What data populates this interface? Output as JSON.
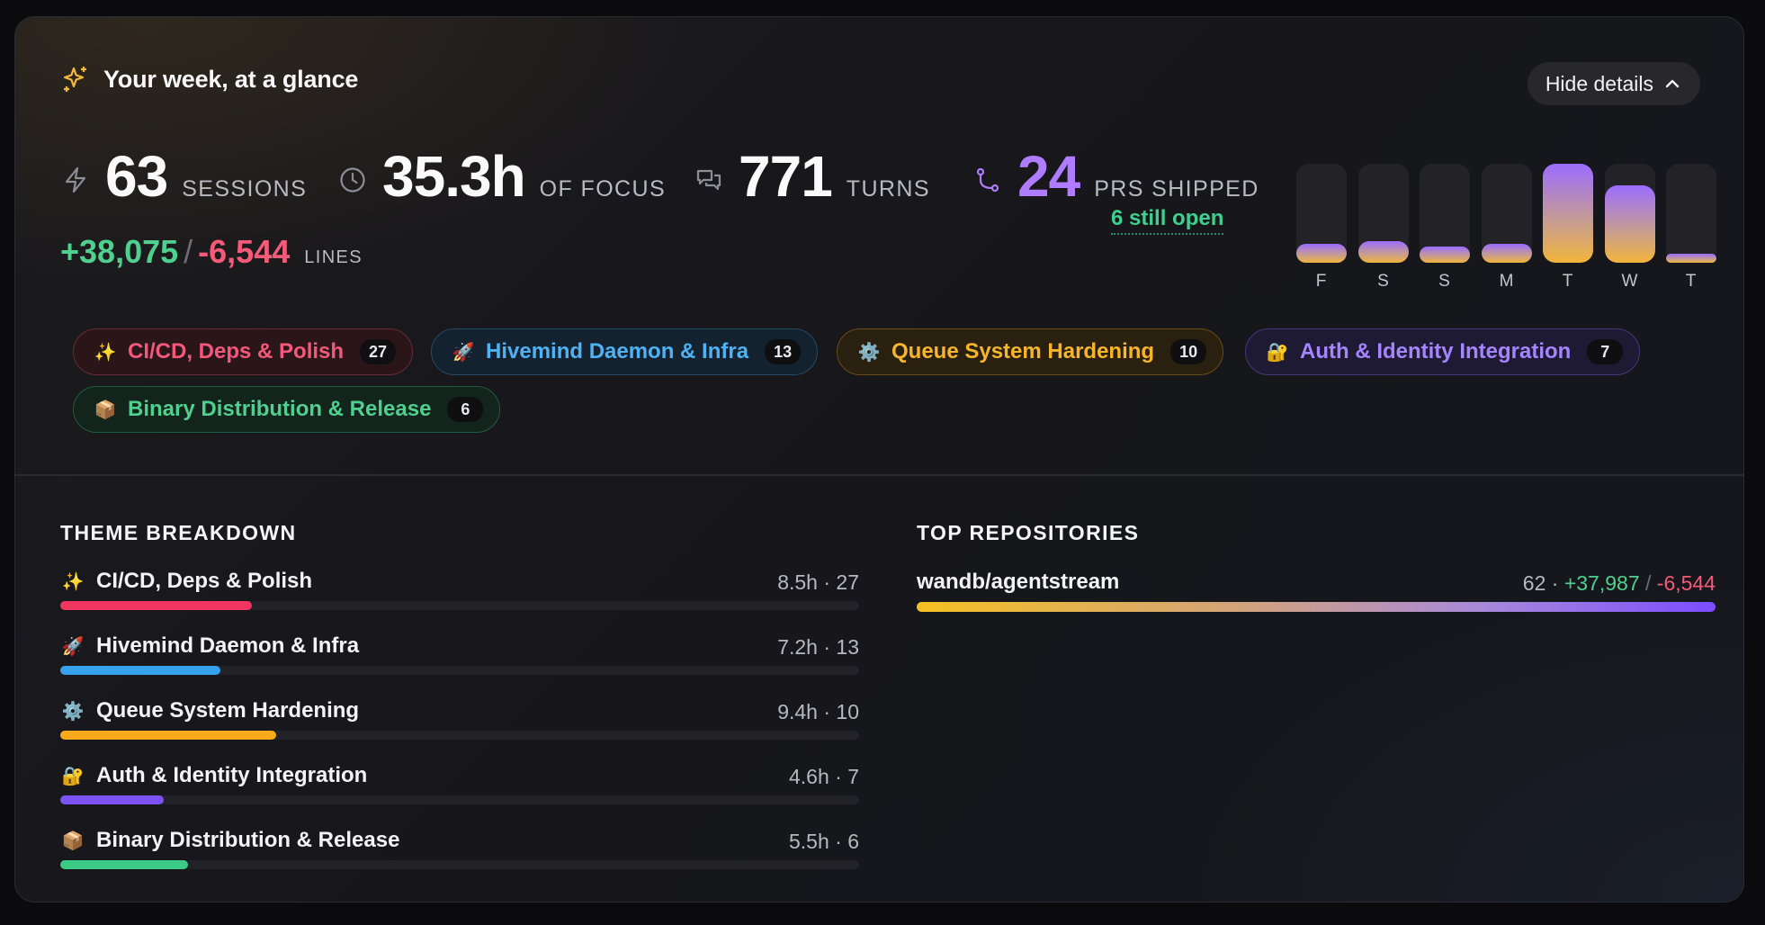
{
  "header": {
    "title": "Your week, at a glance",
    "hide_button_label": "Hide details",
    "title_icon": "sparkles-icon",
    "accent_color": "#f5b83d"
  },
  "stats": {
    "sessions": {
      "value": "63",
      "label": "SESSIONS",
      "icon": "lightning-icon"
    },
    "focus": {
      "value": "35.3h",
      "label": "OF FOCUS",
      "icon": "clock-icon"
    },
    "turns": {
      "value": "771",
      "label": "TURNS",
      "icon": "chat-bubbles-icon"
    },
    "prs": {
      "value": "24",
      "label": "PRS SHIPPED",
      "icon": "git-pull-request-icon",
      "sub": "6 still open",
      "color": "#b07cff"
    },
    "lines": {
      "added": "+38,075",
      "separator": "/",
      "removed": "-6,544",
      "label": "LINES"
    }
  },
  "chart_data": {
    "type": "bar",
    "categories": [
      "F",
      "S",
      "S",
      "M",
      "T",
      "W",
      "T"
    ],
    "values": [
      0.19,
      0.22,
      0.16,
      0.19,
      1.0,
      0.78,
      0.09
    ],
    "ylim": [
      0,
      1
    ],
    "xlabel": "",
    "ylabel": ""
  },
  "chips": [
    {
      "emoji": "✨",
      "label": "CI/CD, Deps & Polish",
      "count": "27",
      "color": "#f4587a",
      "border": "#6a2a38",
      "bg": "#2a1519"
    },
    {
      "emoji": "🚀",
      "label": "Hivemind Daemon & Infra",
      "count": "13",
      "color": "#4eb2f5",
      "border": "#234a66",
      "bg": "#142230"
    },
    {
      "emoji": "⚙️",
      "label": "Queue System Hardening",
      "count": "10",
      "color": "#f7b52c",
      "border": "#6a4c16",
      "bg": "#2a2010"
    },
    {
      "emoji": "🔐",
      "label": "Auth & Identity Integration",
      "count": "7",
      "color": "#a585ff",
      "border": "#47367a",
      "bg": "#1f1a33"
    },
    {
      "emoji": "📦",
      "label": "Binary Distribution & Release",
      "count": "6",
      "color": "#4fd08f",
      "border": "#1f5c41",
      "bg": "#12241c"
    }
  ],
  "breakdown": {
    "title": "THEME BREAKDOWN",
    "items": [
      {
        "emoji": "✨",
        "name": "CI/CD, Deps & Polish",
        "meta": "8.5h · 27",
        "fraction": 0.24,
        "color": "#f0365f"
      },
      {
        "emoji": "🚀",
        "name": "Hivemind Daemon & Infra",
        "meta": "7.2h · 13",
        "fraction": 0.2,
        "color": "#36a2ee"
      },
      {
        "emoji": "⚙️",
        "name": "Queue System Hardening",
        "meta": "9.4h · 10",
        "fraction": 0.27,
        "color": "#f6aa1c"
      },
      {
        "emoji": "🔐",
        "name": "Auth & Identity Integration",
        "meta": "4.6h · 7",
        "fraction": 0.13,
        "color": "#7d52f2"
      },
      {
        "emoji": "📦",
        "name": "Binary Distribution & Release",
        "meta": "5.5h · 6",
        "fraction": 0.16,
        "color": "#3ccb84"
      }
    ]
  },
  "repos": {
    "title": "TOP REPOSITORIES",
    "items": [
      {
        "name": "wandb/agentstream",
        "sessions": "62",
        "dot": "·",
        "added": "+37,987",
        "slash": "/",
        "removed": "-6,544",
        "fraction": 1.0
      }
    ]
  }
}
